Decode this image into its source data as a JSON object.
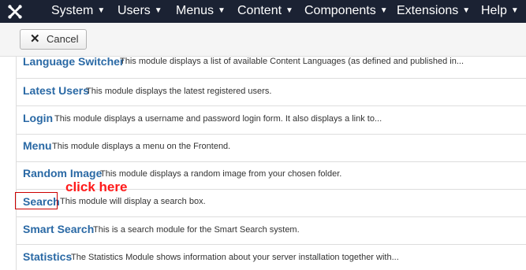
{
  "nav": {
    "items": [
      "System",
      "Users",
      "Menus",
      "Content",
      "Components",
      "Extensions",
      "Help"
    ]
  },
  "toolbar": {
    "cancel_label": "Cancel"
  },
  "modules": [
    {
      "title": "Language Switcher",
      "description": "This module displays a list of available Content Languages (as defined and published in..."
    },
    {
      "title": "Latest Users",
      "description": "This module displays the latest registered users."
    },
    {
      "title": "Login",
      "description": "This module displays a username and password login form. It also displays a link to..."
    },
    {
      "title": "Menu",
      "description": "This module displays a menu on the Frontend."
    },
    {
      "title": "Random Image",
      "description": "This module displays a random image from your chosen folder."
    },
    {
      "title": "Search",
      "description": "This module will display a search box."
    },
    {
      "title": "Smart Search",
      "description": "This is a search module for the Smart Search system."
    },
    {
      "title": "Statistics",
      "description": "The Statistics Module shows information about your server installation together with..."
    }
  ],
  "annotation": {
    "text": "click here"
  }
}
